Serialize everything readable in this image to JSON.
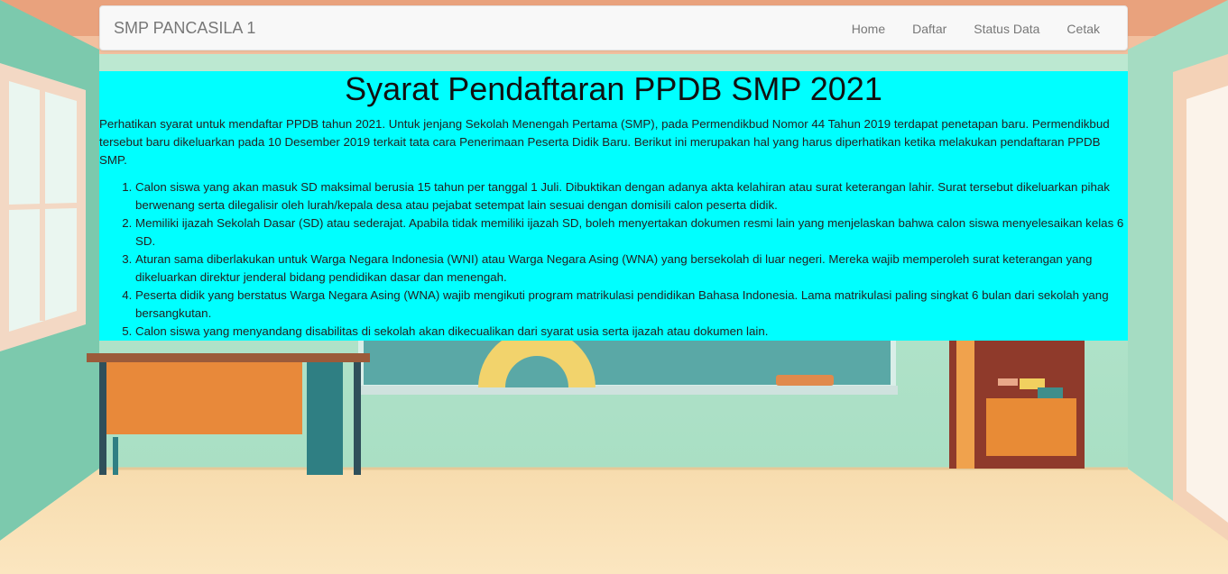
{
  "navbar": {
    "brand": "SMP PANCASILA 1",
    "links": [
      "Home",
      "Daftar",
      "Status Data",
      "Cetak"
    ]
  },
  "main": {
    "title": "Syarat Pendaftaran PPDB SMP 2021",
    "intro": "Perhatikan syarat untuk mendaftar PPDB tahun 2021. Untuk jenjang Sekolah Menengah Pertama (SMP), pada Permendikbud Nomor 44 Tahun 2019 terdapat penetapan baru. Permendikbud tersebut baru dikeluarkan pada 10 Desember 2019 terkait tata cara Penerimaan Peserta Didik Baru. Berikut ini merupakan hal yang harus diperhatikan ketika melakukan pendaftaran PPDB SMP.",
    "requirements": [
      "Calon siswa yang akan masuk SD maksimal berusia 15 tahun per tanggal 1 Juli. Dibuktikan dengan adanya akta kelahiran atau surat keterangan lahir. Surat tersebut dikeluarkan pihak berwenang serta dilegalisir oleh lurah/kepala desa atau pejabat setempat lain sesuai dengan domisili calon peserta didik.",
      "Memiliki ijazah Sekolah Dasar (SD) atau sederajat. Apabila tidak memiliki ijazah SD, boleh menyertakan dokumen resmi lain yang menjelaskan bahwa calon siswa menyelesaikan kelas 6 SD.",
      "Aturan sama diberlakukan untuk Warga Negara Indonesia (WNI) atau Warga Negara Asing (WNA) yang bersekolah di luar negeri. Mereka wajib memperoleh surat keterangan yang dikeluarkan direktur jenderal bidang pendidikan dasar dan menengah.",
      "Peserta didik yang berstatus Warga Negara Asing (WNA) wajib mengikuti program matrikulasi pendidikan Bahasa Indonesia. Lama matrikulasi paling singkat 6 bulan dari sekolah yang bersangkutan.",
      "Calon siswa yang menyandang disabilitas di sekolah akan dikecualikan dari syarat usia serta ijazah atau dokumen lain."
    ]
  },
  "colors": {
    "content_bg": "#00ffff",
    "navbar_bg": "#f8f8f8"
  }
}
